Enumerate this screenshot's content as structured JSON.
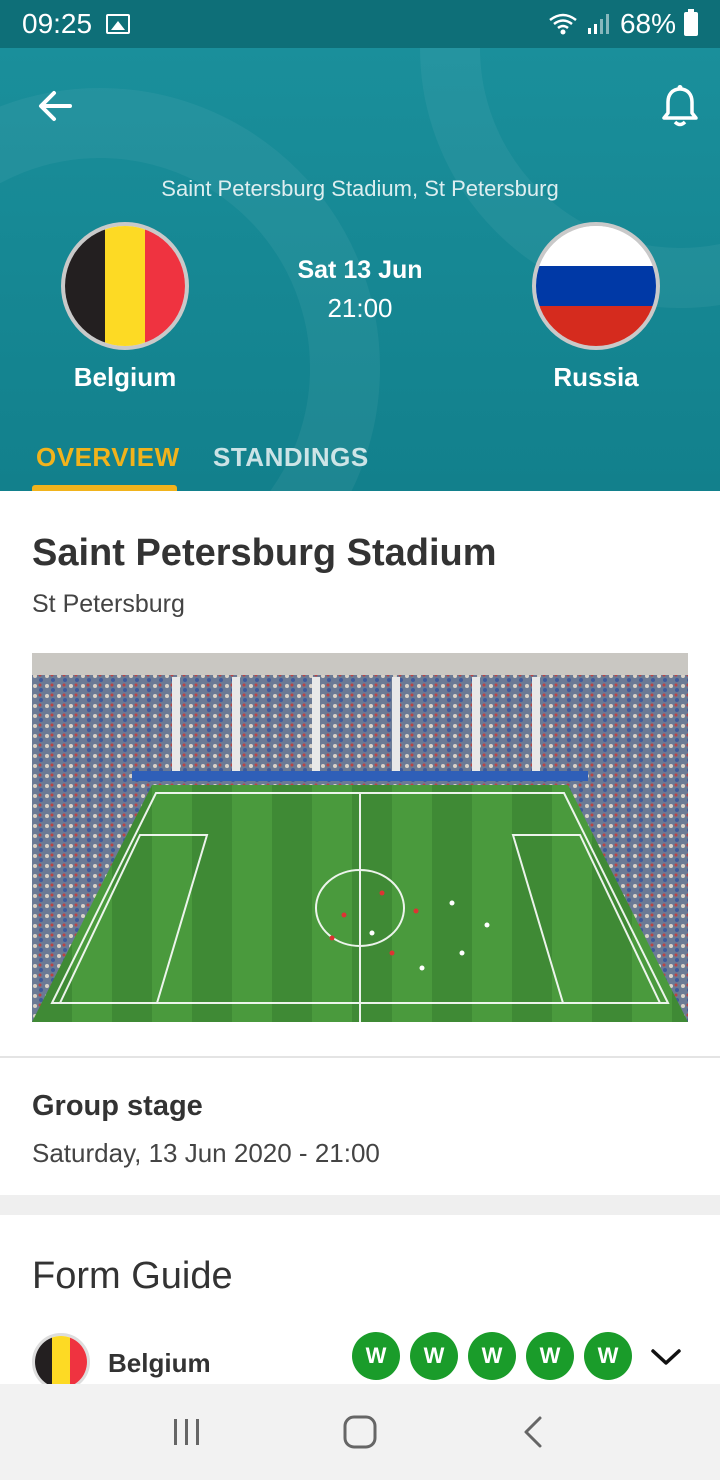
{
  "status_bar": {
    "time": "09:25",
    "battery": "68%",
    "icons": [
      "image-icon",
      "wifi-icon",
      "signal-icon",
      "battery-icon"
    ]
  },
  "header": {
    "venue_line": "Saint Petersburg Stadium, St Petersburg",
    "home_team": {
      "name": "Belgium",
      "flag_colors": [
        "#231f20",
        "#fdda24",
        "#ef3340"
      ]
    },
    "away_team": {
      "name": "Russia",
      "flag_colors": [
        "#ffffff",
        "#0039a6",
        "#d52b1e"
      ]
    },
    "match_date": "Sat 13 Jun",
    "match_time": "21:00",
    "tabs": [
      {
        "label": "OVERVIEW",
        "active": true
      },
      {
        "label": "STANDINGS",
        "active": false
      }
    ],
    "accent_color": "#f1b31c"
  },
  "stadium": {
    "name": "Saint Petersburg Stadium",
    "city": "St Petersburg"
  },
  "stage": {
    "title": "Group stage",
    "datetime": "Saturday, 13 Jun 2020 - 21:00"
  },
  "form_guide": {
    "title": "Form Guide",
    "rows": [
      {
        "team": "Belgium",
        "results": [
          "W",
          "W",
          "W",
          "W",
          "W"
        ]
      }
    ],
    "win_color": "#1a9c2a"
  }
}
